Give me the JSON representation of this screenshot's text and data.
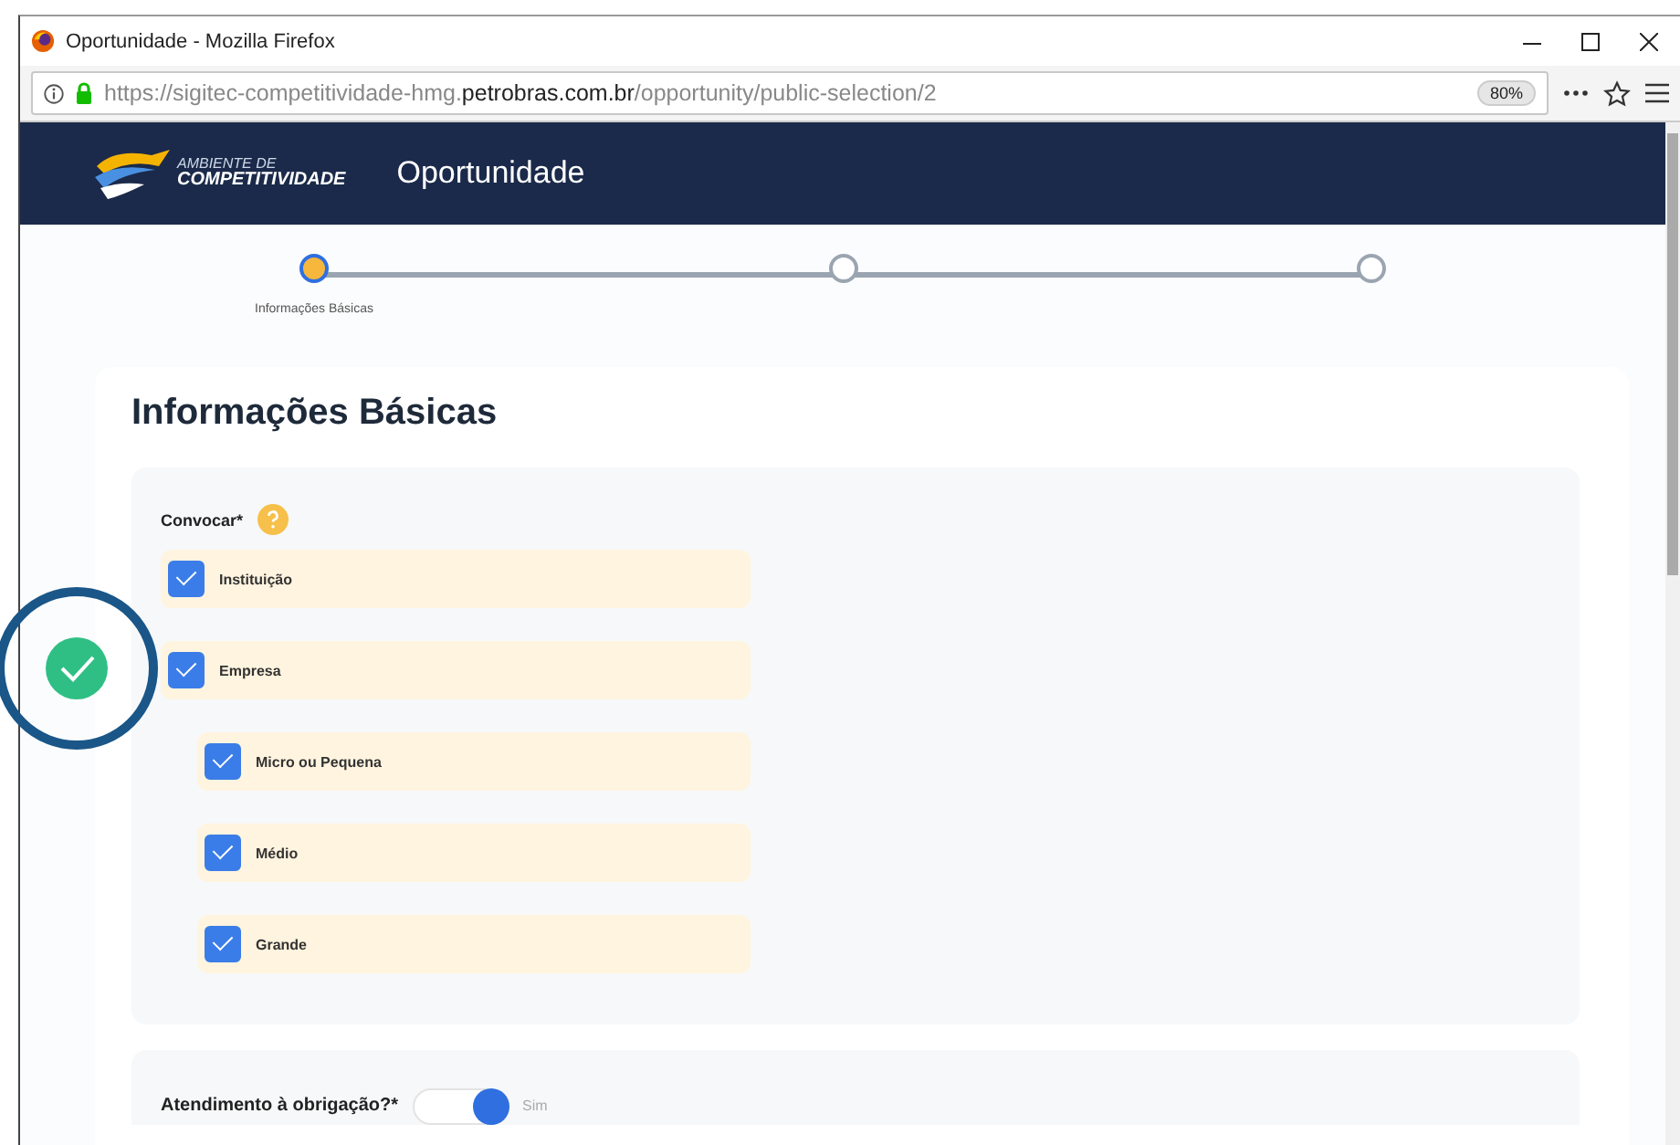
{
  "window": {
    "title": "Oportunidade - Mozilla Firefox"
  },
  "address_bar": {
    "url": "https://sigitec-competitividade-hmg.**petrobras.com.br**/opportunity/public-selection/2",
    "zoom": "80%"
  },
  "header": {
    "logo_line_1": "AMBIENTE DE",
    "logo_line_2": "COMPETITIVIDADE",
    "title": "Oportunidade"
  },
  "stepper": {
    "steps": [
      {
        "label": "Informações Básicas",
        "selected": true
      },
      {
        "selected": false
      },
      {
        "selected": false
      }
    ]
  },
  "form": {
    "title": "Informações Básicas",
    "convocar": {
      "label": "Convocar*",
      "options": [
        {
          "label": "Instituição",
          "checked": true
        },
        {
          "label": "Empresa",
          "checked": true,
          "children": [
            {
              "label": "Micro ou Pequena",
              "checked": true
            },
            {
              "label": "Médio",
              "checked": true
            },
            {
              "label": "Grande",
              "checked": true
            }
          ]
        }
      ]
    },
    "obligation": {
      "label": "Atendimento à obrigação?*",
      "on": true,
      "value_label": "Sim"
    }
  }
}
